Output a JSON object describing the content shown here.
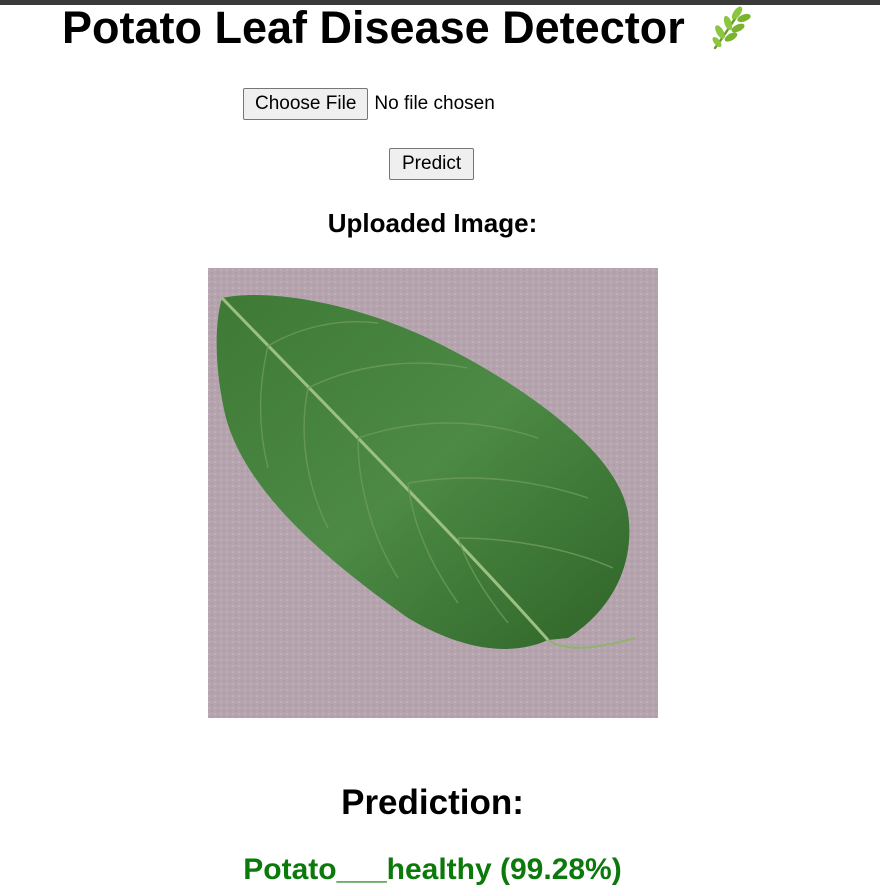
{
  "header": {
    "title": "Potato Leaf Disease Detector",
    "title_icon": "herb-icon"
  },
  "upload": {
    "choose_file_label": "Choose File",
    "file_status": "No file chosen"
  },
  "actions": {
    "predict_label": "Predict"
  },
  "preview": {
    "heading": "Uploaded Image:",
    "image_subject": "green potato leaf on mauve background"
  },
  "result": {
    "heading": "Prediction:",
    "text": "Potato___healthy (99.28%)",
    "color": "#0b7a0b"
  }
}
